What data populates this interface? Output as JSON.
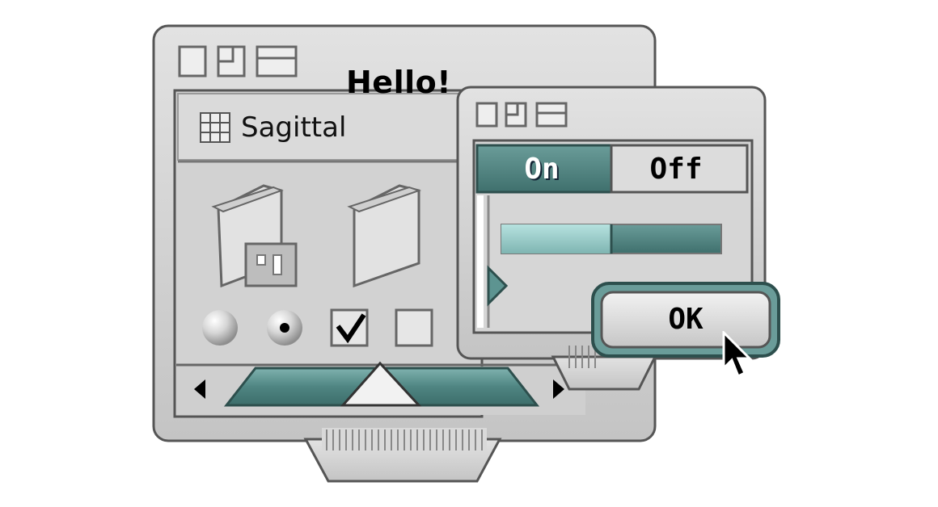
{
  "main_window": {
    "title": "Hello!",
    "pane_label": "Sagittal"
  },
  "small_window": {
    "segmented": {
      "on_label": "On",
      "off_label": "Off",
      "selected": "On"
    },
    "progress": {
      "value": 0.5
    }
  },
  "ok_button": {
    "label": "OK"
  },
  "colors": {
    "accent": "#4f8582",
    "accent_light": "#8fc5c2",
    "window_face": "#cfcfcf",
    "shadow": "#8a8a8a",
    "highlight": "#f4f4f4"
  },
  "icons": [
    "grid-icon",
    "folder-icon",
    "radio-icon",
    "checkbox-icon",
    "arrow-pointer-icon"
  ]
}
